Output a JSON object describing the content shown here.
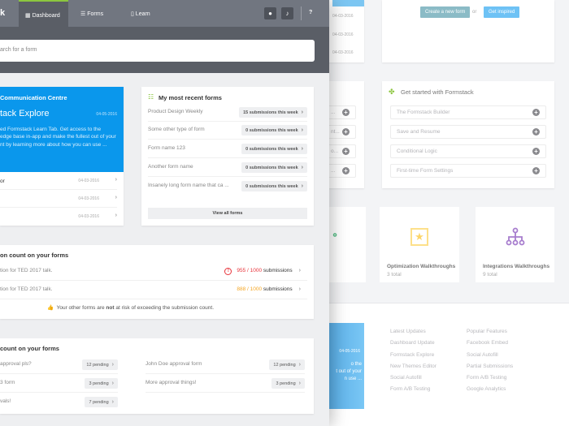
{
  "background": {
    "top_card": {
      "create_label": "Create a new form",
      "or_label": "or",
      "inspired_label": "Get inspired"
    },
    "partial_dates": [
      "04-03-2016",
      "04-03-2016",
      "04-03-2016"
    ],
    "partial_items": [
      "...",
      "nt...",
      "o...",
      "..."
    ],
    "get_started": {
      "title": "Get started with Formstack",
      "items": [
        "The Formstack Builder",
        "Save and Resume",
        "Conditional Logic",
        "First-time Form Settings"
      ]
    },
    "tiles": [
      {
        "title": "Optimization Walkthroughs",
        "count": "3 total"
      },
      {
        "title": "Integrations Walkthroughs",
        "count": "9 total"
      }
    ],
    "blue_card": {
      "date": "04-05-2016",
      "text": [
        "o the",
        "t out of your",
        "n use ..."
      ]
    },
    "latest_updates": {
      "title": "Latest Updates",
      "items": [
        "Dashboard Update",
        "Formstack Explore",
        "New Themes Editor",
        "Social Autofill",
        "Form A/B Testing"
      ]
    },
    "popular_features": {
      "title": "Popular Features",
      "items": [
        "Facebook Embed",
        "Social Autofill",
        "Partial Submissions",
        "Form A/B Testing",
        "Google Analytics"
      ]
    }
  },
  "nav": {
    "logo": "k",
    "tabs": [
      "Dashboard",
      "Forms",
      "Learn"
    ],
    "help": "?"
  },
  "search": {
    "placeholder": "arch for a form"
  },
  "communication": {
    "header": "Communication Centre",
    "title": "tack Explore",
    "date": "04-05-2016",
    "body": [
      "ed Formstack Learn Tab. Get access to the",
      "edge base in-app and make the fullest out of your",
      "nt by learning more about how you can use ..."
    ],
    "items": [
      {
        "label": "or",
        "date": "04-03-2016"
      },
      {
        "label": "",
        "date": "04-03-2016"
      },
      {
        "label": "",
        "date": "04-03-2016"
      }
    ]
  },
  "recent_forms": {
    "title": "My most recent forms",
    "items": [
      {
        "name": "Product Design Weekly",
        "count": "15 submissions this week"
      },
      {
        "name": "Some other type of form",
        "count": "0 submissions this week"
      },
      {
        "name": "Form name 123",
        "count": "0 submissions this week"
      },
      {
        "name": "Another form name",
        "count": "0 submissions this week"
      },
      {
        "name": "Insanely long form name that ca ...",
        "count": "0 submissions this week"
      }
    ],
    "view_all": "View all forms"
  },
  "submission_count": {
    "title": "on count on your forms",
    "items": [
      {
        "name": "tion for TED 2017 talk.",
        "count": "955 / 1000",
        "suffix": "submissions",
        "color": "#e8333a"
      },
      {
        "name": "tion for TED 2017 talk.",
        "count": "888 / 1000",
        "suffix": "submissions",
        "color": "#f5a623"
      }
    ],
    "note_pre": "Your other forms are ",
    "note_bold": "not",
    "note_post": " at risk of exceeding the submission count."
  },
  "approvals": {
    "title": "count on your forms",
    "left": [
      {
        "name": "approval pls?",
        "count": "12 pending"
      },
      {
        "name": "3 form",
        "count": "3 pending"
      },
      {
        "name": "vals!",
        "count": "7 pending"
      }
    ],
    "right": [
      {
        "name": "John Doe approval form",
        "count": "12 pending"
      },
      {
        "name": "More approval things!",
        "count": "3 pending"
      }
    ]
  }
}
